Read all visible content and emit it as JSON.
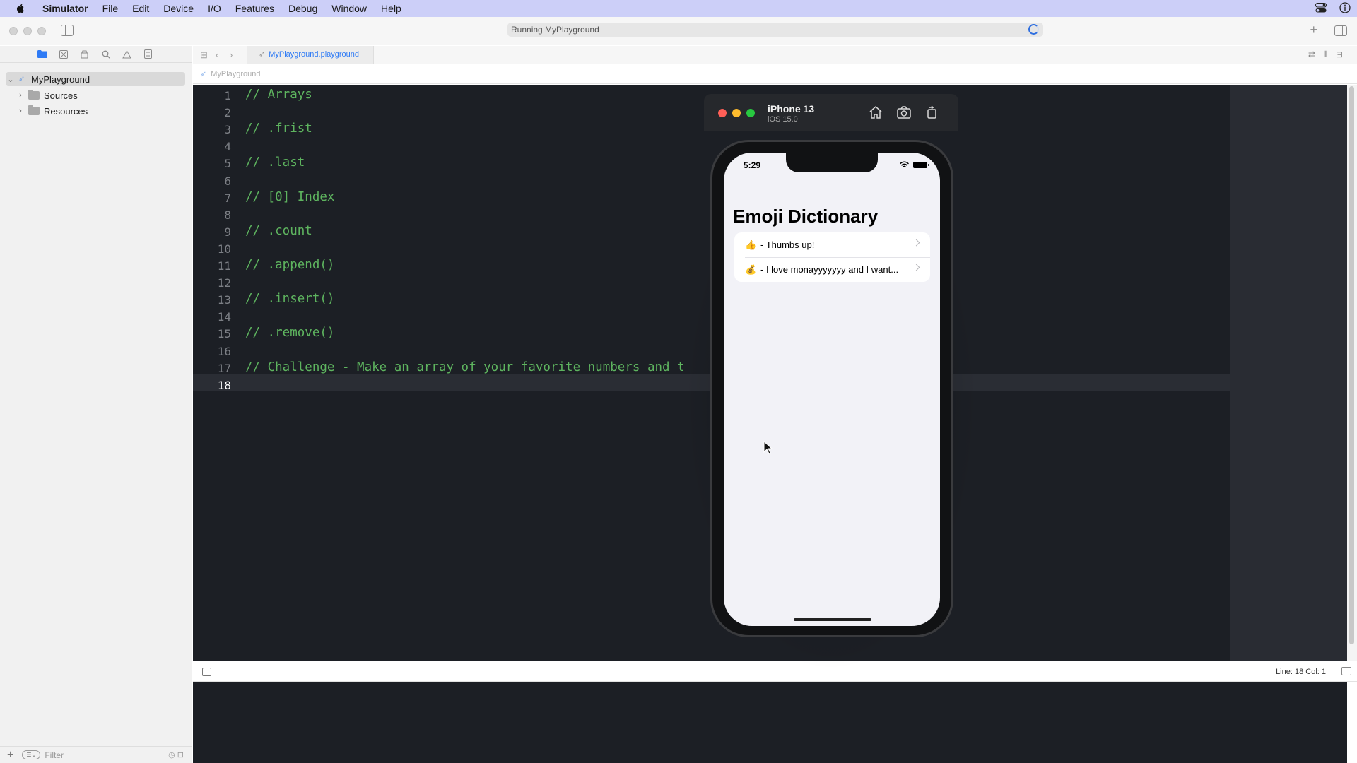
{
  "menubar": {
    "apple_icon": "apple-icon",
    "app": "Simulator",
    "items": [
      "File",
      "Edit",
      "Device",
      "I/O",
      "Features",
      "Debug",
      "Window",
      "Help"
    ],
    "right_icons": [
      "control-center-icon",
      "info-icon"
    ]
  },
  "toolbar": {
    "activity": "Running MyPlayground",
    "add_icon": "plus-icon"
  },
  "navigator": {
    "project": "MyPlayground",
    "items": [
      {
        "label": "Sources"
      },
      {
        "label": "Resources"
      }
    ],
    "filter_placeholder": "Filter"
  },
  "editor": {
    "tab": "MyPlayground.playground",
    "jumpbar": "MyPlayground",
    "lines": [
      {
        "num": "1",
        "text": "// Arrays"
      },
      {
        "num": "2",
        "text": ""
      },
      {
        "num": "3",
        "text": "// .frist"
      },
      {
        "num": "4",
        "text": ""
      },
      {
        "num": "5",
        "text": "// .last"
      },
      {
        "num": "6",
        "text": ""
      },
      {
        "num": "7",
        "text": "// [0] Index"
      },
      {
        "num": "8",
        "text": ""
      },
      {
        "num": "9",
        "text": "// .count"
      },
      {
        "num": "10",
        "text": ""
      },
      {
        "num": "11",
        "text": "// .append()"
      },
      {
        "num": "12",
        "text": ""
      },
      {
        "num": "13",
        "text": "// .insert()"
      },
      {
        "num": "14",
        "text": ""
      },
      {
        "num": "15",
        "text": "// .remove()"
      },
      {
        "num": "16",
        "text": ""
      },
      {
        "num": "17",
        "text": "// Challenge - Make an array of your favorite numbers and t"
      },
      {
        "num": "18",
        "text": ""
      }
    ],
    "status": "Line: 18  Col: 1"
  },
  "simulator": {
    "device": "iPhone 13",
    "os": "iOS 15.0",
    "icons": [
      "home-icon",
      "screenshot-icon",
      "rotate-icon"
    ],
    "status_time": "5:29",
    "title": "Emoji Dictionary",
    "rows": [
      {
        "emoji": "👍",
        "text": "- Thumbs up!"
      },
      {
        "emoji": "💰",
        "text": "- I love monayyyyyyy  and I want..."
      }
    ]
  }
}
